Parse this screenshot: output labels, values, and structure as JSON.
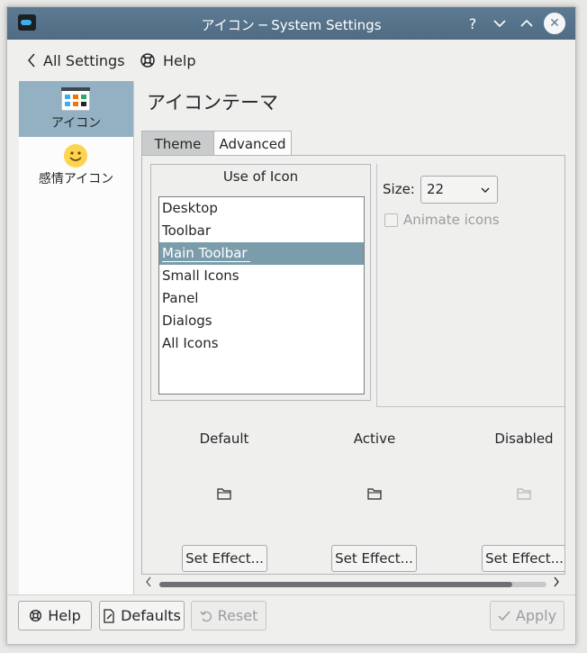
{
  "window": {
    "title": "アイコン  ─ System Settings",
    "help_glyph": "?",
    "minimize_glyph": "﹀",
    "maximize_glyph": "︿",
    "close_glyph": "✕"
  },
  "navbar": {
    "back_label": "All Settings",
    "help_label": "Help"
  },
  "sidebar": {
    "items": [
      {
        "label": "アイコン",
        "icon": "icons-module-icon",
        "selected": true
      },
      {
        "label": "感情アイコン",
        "icon": "emoticon-icon",
        "selected": false
      }
    ]
  },
  "page": {
    "title": "アイコンテーマ",
    "tabs": [
      {
        "label": "Theme",
        "active": false
      },
      {
        "label": "Advanced",
        "active": true
      }
    ]
  },
  "use_of_icon": {
    "title": "Use of Icon",
    "items": [
      "Desktop",
      "Toolbar",
      "Main Toolbar",
      "Small Icons",
      "Panel",
      "Dialogs",
      "All Icons"
    ],
    "selected": "Main Toolbar"
  },
  "size": {
    "label": "Size:",
    "value": "22",
    "chevron": "⌄"
  },
  "animate": {
    "label": "Animate icons",
    "checked": false,
    "enabled": false
  },
  "effects": {
    "columns": [
      {
        "label": "Default",
        "button": "Set Effect..."
      },
      {
        "label": "Active",
        "button": "Set Effect..."
      },
      {
        "label": "Disabled",
        "button": "Set Effect..."
      }
    ]
  },
  "footer": {
    "help_label": "Help",
    "defaults_label": "Defaults",
    "reset_label": "Reset",
    "apply_label": "Apply",
    "reset_enabled": false,
    "apply_enabled": false
  },
  "colors": {
    "titlebar": "#54718a",
    "selection": "#93b1c2",
    "list_selection": "#7a9cab"
  }
}
